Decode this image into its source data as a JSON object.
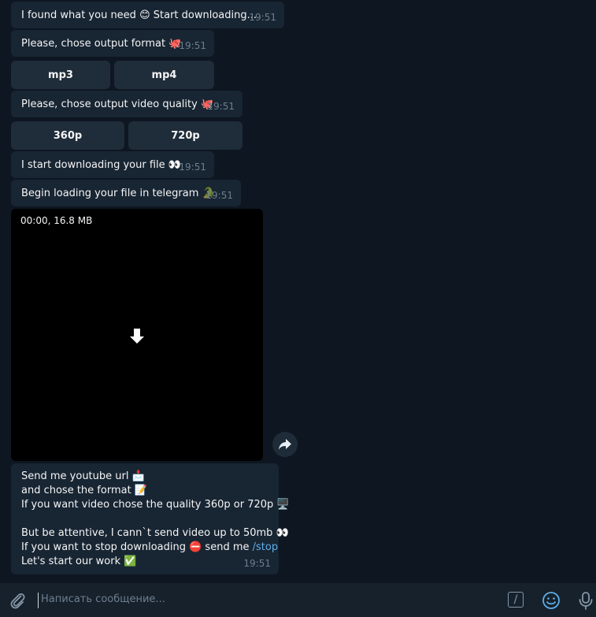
{
  "messages": [
    {
      "text": "I found what you need 😊 Start downloading...",
      "time": "19:51"
    },
    {
      "text": "Please, chose output format 🐙",
      "time": "19:51"
    },
    {
      "text": "Please, chose output video quality 🐙",
      "time": "19:51"
    },
    {
      "text": "I start downloading your file 👀",
      "time": "19:51"
    },
    {
      "text": "Begin loading your file in telegram 🐊",
      "time": "19:51"
    }
  ],
  "format_buttons": [
    "mp3",
    "mp4"
  ],
  "quality_buttons": [
    "360p",
    "720p"
  ],
  "video": {
    "meta": "00:00, 16.8 MB"
  },
  "info": {
    "line1": "Send me youtube url 📩",
    "line2": "and chose the format 📝",
    "line3": "If you want video chose the quality 360p or 720p 🖥️",
    "line4": "But be attentive, I cann`t send video up to 50mb 👀",
    "line5_pre": "If you want to stop downloading ⛔ send me ",
    "line5_cmd": "/stop",
    "line6": "Let's start our work ✅",
    "time": "19:51"
  },
  "composer": {
    "placeholder": "Написать сообщение..."
  },
  "colors": {
    "background": "#0e1621",
    "bubble": "#182533",
    "accent": "#5eaee8"
  }
}
